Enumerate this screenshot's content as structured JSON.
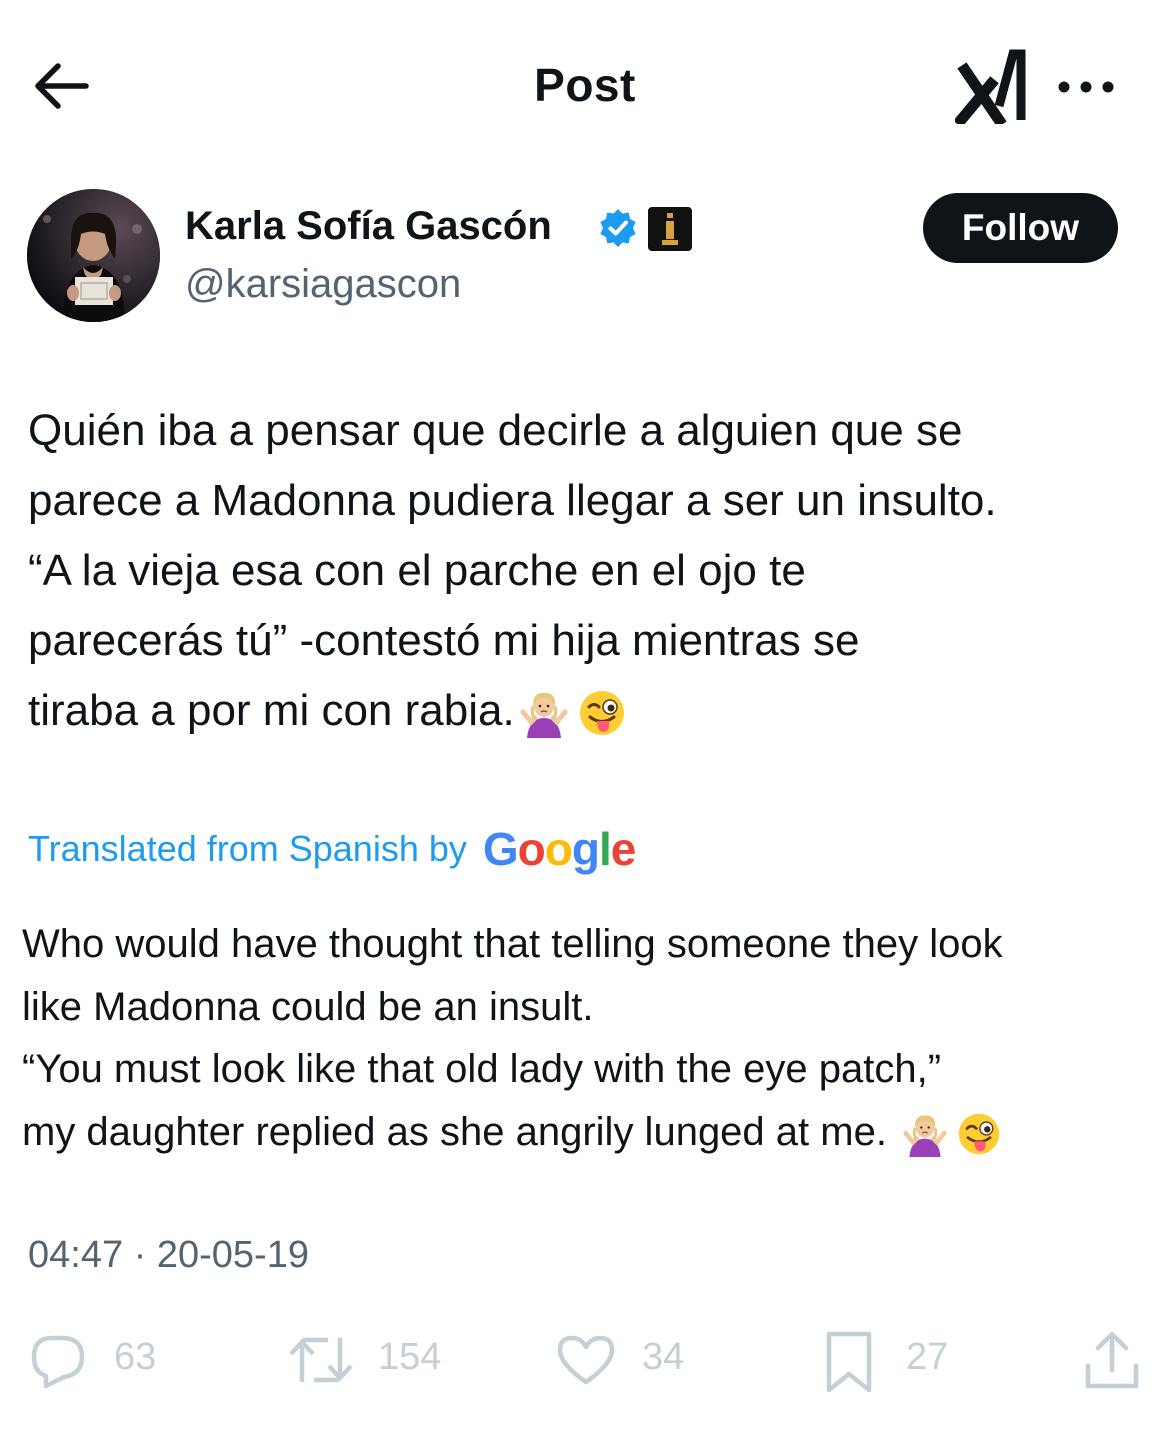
{
  "header": {
    "title": "Post",
    "back_icon": "arrow-left-icon",
    "grok_icon": "grok-icon",
    "more_icon": "more-horizontal-icon"
  },
  "author": {
    "name": "Karla Sofía Gascón",
    "handle": "@karsiagascon",
    "verified_color": "#1d9bf0",
    "follow_label": "Follow"
  },
  "tweet": {
    "lines": [
      "Quién iba a pensar que decirle a alguien que se",
      "parece a Madonna pudiera llegar a ser un insulto.",
      "“A la vieja esa con el parche en el ojo te",
      "parecerás tú” -contestó mi hija mientras se",
      "tiraba a por mi con rabia."
    ],
    "emojis": [
      "person-shrugging",
      "winking-face-with-tongue"
    ]
  },
  "translation": {
    "label": "Translated from Spanish by",
    "provider": "Google",
    "lines": [
      "Who would have thought that telling someone they look",
      "like Madonna could be an insult.",
      "“You must look like that old lady with the eye patch,”",
      "my daughter replied as she angrily lunged at me."
    ]
  },
  "timestamp": "04:47 · 20-05-19",
  "actions": {
    "replies": "63",
    "reposts": "154",
    "likes": "34",
    "bookmarks": "27"
  },
  "colors": {
    "accent": "#1d9bf0",
    "text": "#0f1419",
    "secondary": "#536471",
    "action_gray": "#c4cfd6"
  }
}
